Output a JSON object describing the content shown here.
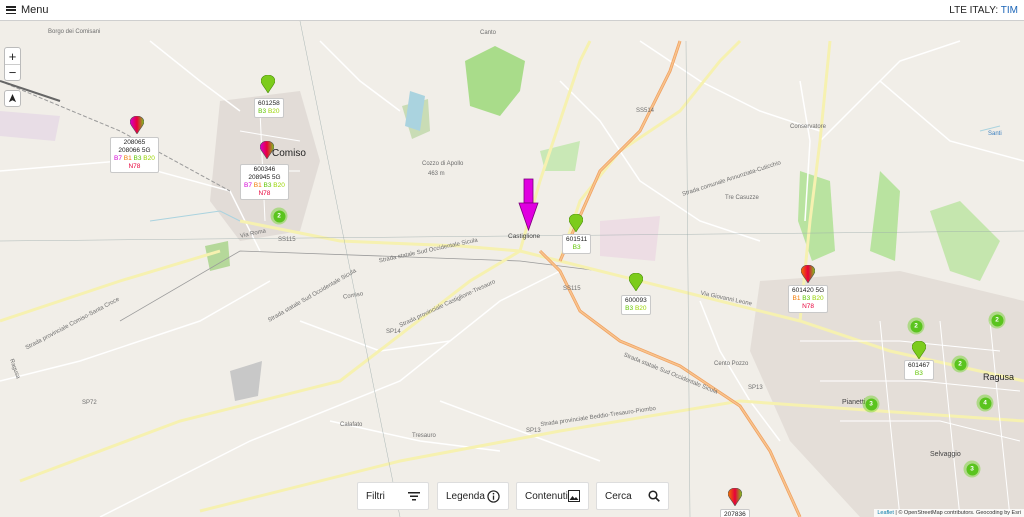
{
  "header": {
    "menu_label": "Menu",
    "carrier_prefix": "LTE ITALY:",
    "carrier_name": "TIM"
  },
  "map": {
    "zoom_in": "+",
    "zoom_out": "−",
    "places": {
      "comiso": "Comiso",
      "castiglione": "Castiglione",
      "ragusa": "Ragusa",
      "pianetti": "Pianetti",
      "selvaggio": "Selvaggio",
      "tre_casuzze": "Tre Casuzze",
      "cento_pozzo": "Cento Pozzo",
      "conservatore": "Conservatore",
      "calafato": "Calafato",
      "tresauro": "Tresauro",
      "borgo_comisani": "Borgo dei Comisani",
      "cozzo_apollo": "Cozzo di Apollo",
      "cozzo_height": "463 m",
      "santi": "Santi",
      "ragusa_small": "Ragusa",
      "comiso_small": "Comiso",
      "canto": "Canto"
    },
    "roads": {
      "ss514": "SS514",
      "ss115": "SS115",
      "ss115b": "SS115",
      "sp14": "SP14",
      "sp13": "SP13",
      "sp13b": "SP13",
      "sp72": "SP72",
      "ss_sud": "Strada statale Sud Occidentale Sicula",
      "ss_sud2": "Strada statale Sud Occidentale Sicula",
      "ss_sud3": "Strada statale Sud Occidentale Sicula",
      "sp_castiglione": "Strada provinciale Castiglione-Tresauro",
      "sp_beddio": "Strada provinciale Beddio-Tresauro-Piombo",
      "sp_comiso": "Strada provinciale Comiso-Santa Croce",
      "via_leone": "Via Giovanni Leone",
      "strada_comunale": "Strada comunale Annunziata-Cuticchio",
      "viale_europa": "Via Roma"
    },
    "attribution": {
      "leaflet": "Leaflet",
      "rest": "| © OpenStreetMap contributors. Geocoding by Esri"
    }
  },
  "sites": [
    {
      "id": "601258",
      "lines": [
        [
          [
            "B3",
            "green"
          ],
          [
            "B20",
            "lime"
          ]
        ]
      ]
    },
    {
      "id": "208065",
      "lines": [
        [
          "208066 5G"
        ],
        [
          [
            "B7",
            "pink"
          ],
          [
            "B1",
            "orange"
          ],
          [
            "B3",
            "green"
          ],
          [
            "B20",
            "lime"
          ]
        ],
        [
          [
            "N78",
            "red"
          ]
        ]
      ]
    },
    {
      "id": "600346",
      "lines": [
        [
          "208945 5G"
        ],
        [
          [
            "B7",
            "pink"
          ],
          [
            "B1",
            "orange"
          ],
          [
            "B3",
            "green"
          ],
          [
            "B20",
            "lime"
          ]
        ],
        [
          [
            "N78",
            "red"
          ]
        ]
      ]
    },
    {
      "id": "601511",
      "lines": [
        [
          [
            "B3",
            "green"
          ]
        ]
      ]
    },
    {
      "id": "600093",
      "lines": [
        [
          [
            "B3",
            "green"
          ],
          [
            "B20",
            "lime"
          ]
        ]
      ]
    },
    {
      "id": "601420 5G",
      "lines": [
        [
          [
            "B1",
            "orange"
          ],
          [
            "B3",
            "green"
          ],
          [
            "B20",
            "lime"
          ]
        ],
        [
          [
            "N78",
            "red"
          ]
        ]
      ]
    },
    {
      "id": "601467",
      "lines": [
        [
          [
            "B3",
            "green"
          ]
        ]
      ]
    },
    {
      "id": "207836",
      "lines": []
    }
  ],
  "clusters": [
    "2",
    "2",
    "2",
    "2",
    "3",
    "4",
    "3"
  ],
  "toolbar": {
    "filtri": "Filtri",
    "legenda": "Legenda",
    "contenuti": "Contenuti",
    "cerca": "Cerca"
  },
  "colors": {
    "pink": "#d400d4",
    "orange": "#f07800",
    "green": "#5fc400",
    "lime": "#9ad400",
    "red": "#e8003a",
    "marker_arrow": "#e000e0"
  }
}
